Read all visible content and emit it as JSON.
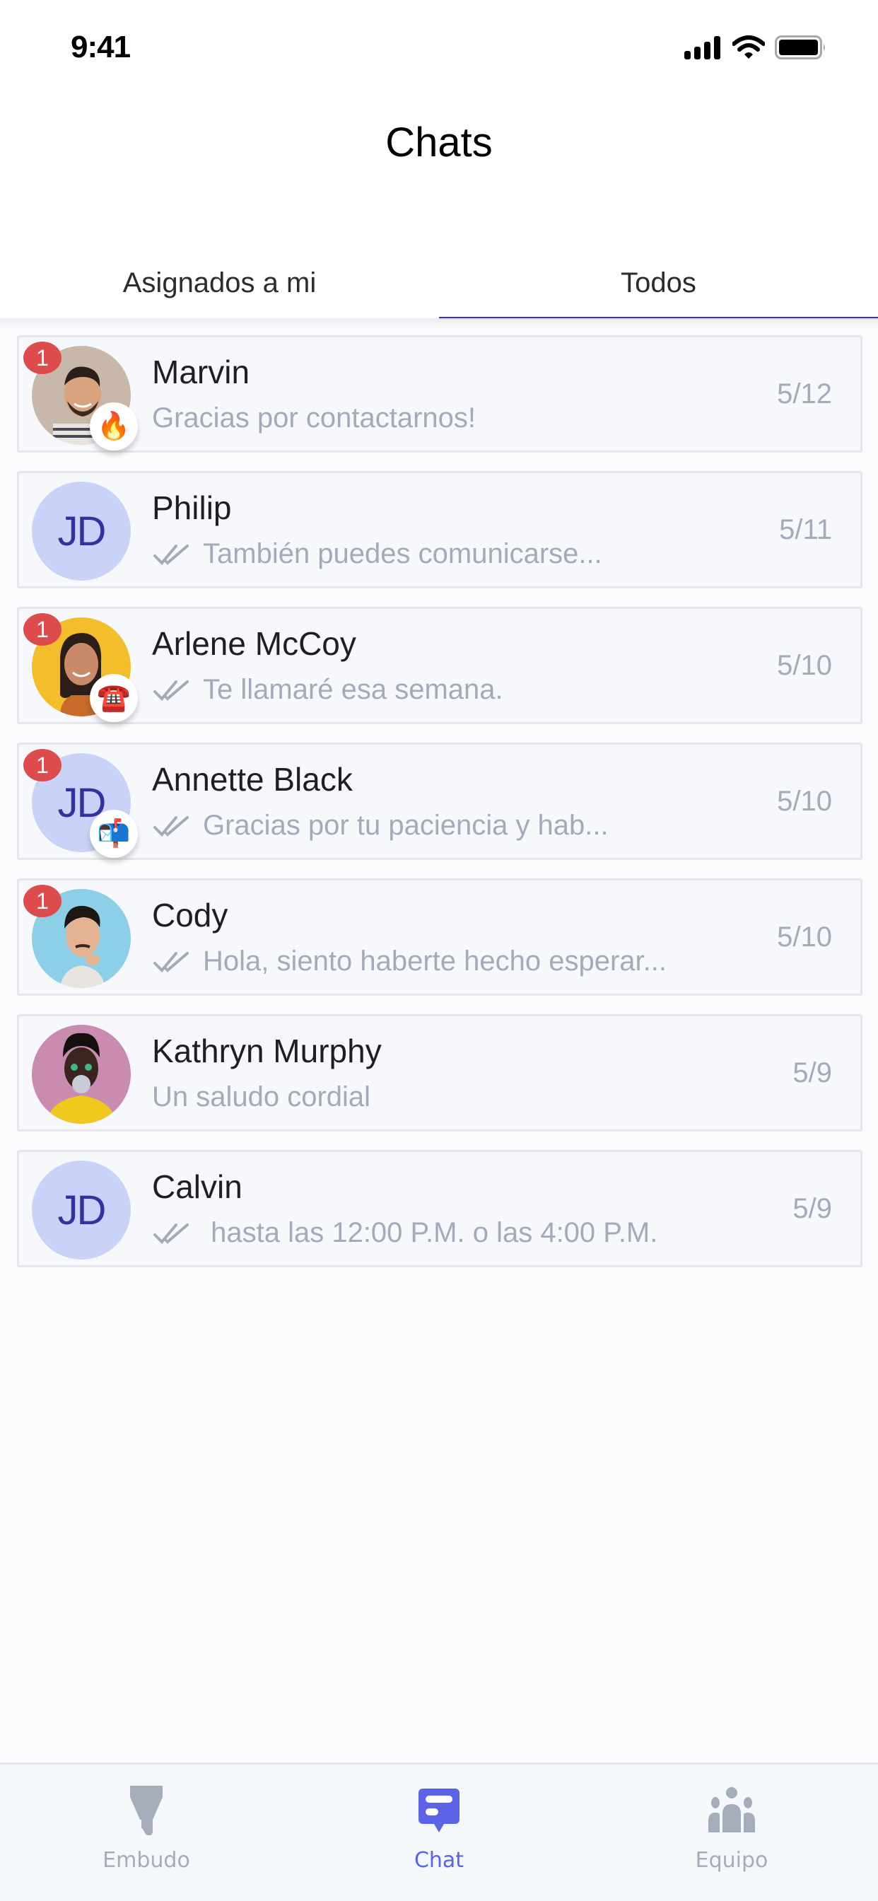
{
  "status_bar": {
    "time": "9:41",
    "icons": [
      "signal-icon",
      "wifi-icon",
      "battery-icon"
    ]
  },
  "header": {
    "title": "Chats"
  },
  "tabs": [
    {
      "label": "Asignados a mi",
      "active": false
    },
    {
      "label": "Todos",
      "active": true
    }
  ],
  "colors": {
    "accent": "#3b32a0",
    "nav_active": "#5b63e6",
    "badge": "#dc4c4c",
    "initials_bg": "#c9d3f7",
    "initials_text": "#3730a3",
    "muted": "#a3aab9"
  },
  "chats": [
    {
      "name": "Marvin",
      "preview": "Gracias por contactarnos!",
      "date": "5/12",
      "unread": "1",
      "avatar": "photo",
      "emoji": "🔥",
      "read_receipt": false
    },
    {
      "name": "Philip",
      "preview": "También puedes comunicarse...",
      "date": "5/11",
      "unread": "",
      "avatar": "JD",
      "emoji": "",
      "read_receipt": true
    },
    {
      "name": "Arlene McCoy",
      "preview": "Te llamaré esa semana.",
      "date": "5/10",
      "unread": "1",
      "avatar": "photo",
      "emoji": "☎️",
      "read_receipt": true
    },
    {
      "name": "Annette Black",
      "preview": "Gracias por tu paciencia y hab...",
      "date": "5/10",
      "unread": "1",
      "avatar": "JD",
      "emoji": "📬",
      "read_receipt": true
    },
    {
      "name": "Cody",
      "preview": "Hola, siento haberte hecho esperar...",
      "date": "5/10",
      "unread": "1",
      "avatar": "photo",
      "emoji": "",
      "read_receipt": true
    },
    {
      "name": "Kathryn Murphy",
      "preview": "Un saludo cordial",
      "date": "5/9",
      "unread": "",
      "avatar": "photo",
      "emoji": "",
      "read_receipt": false
    },
    {
      "name": "Calvin",
      "preview": " hasta las 12:00 P.M. o las 4:00 P.M.",
      "date": "5/9",
      "unread": "",
      "avatar": "JD",
      "emoji": "",
      "read_receipt": true
    }
  ],
  "bottom_nav": [
    {
      "label": "Embudo",
      "icon": "funnel-icon",
      "active": false
    },
    {
      "label": "Chat",
      "icon": "chat-icon",
      "active": true
    },
    {
      "label": "Equipo",
      "icon": "team-icon",
      "active": false
    }
  ]
}
